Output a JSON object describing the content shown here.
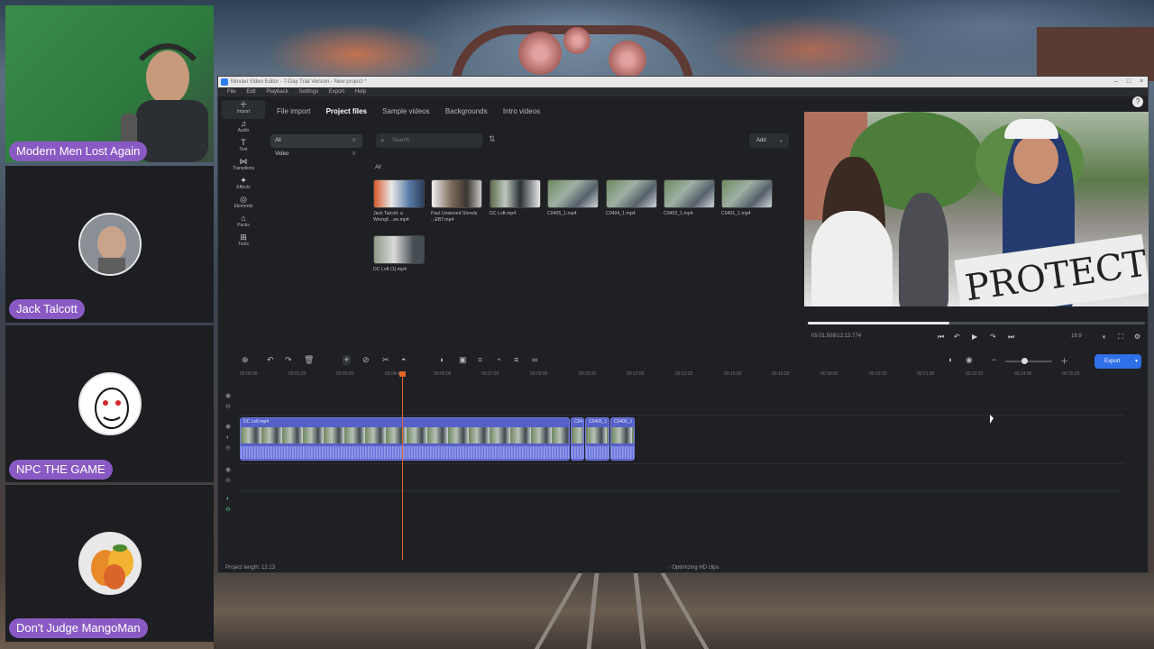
{
  "window": {
    "title": "Movavi Video Editor - 7-Day Trial Version - New project *",
    "controls": [
      "minimize-icon",
      "maximize-icon",
      "close-icon"
    ]
  },
  "menu": [
    "File",
    "Edit",
    "Playback",
    "Settings",
    "Export",
    "Help"
  ],
  "tools": [
    {
      "icon": "plus-icon",
      "label": "Import"
    },
    {
      "icon": "music-note-icon",
      "label": "Audio"
    },
    {
      "icon": "text-icon",
      "label": "Text"
    },
    {
      "icon": "transitions-icon",
      "label": "Transitions"
    },
    {
      "icon": "effects-icon",
      "label": "Effects"
    },
    {
      "icon": "elements-icon",
      "label": "Elements"
    },
    {
      "icon": "packs-icon",
      "label": "Packs"
    },
    {
      "icon": "tools-icon",
      "label": "Tools"
    }
  ],
  "tabs": [
    "File import",
    "Project files",
    "Sample videos",
    "Backgrounds",
    "Intro videos"
  ],
  "active_tab": "Project files",
  "filters": [
    {
      "label": "All",
      "count": "8"
    },
    {
      "label": "Video",
      "count": "8"
    }
  ],
  "search": {
    "placeholder": "Search"
  },
  "add_button": "Add",
  "section_label": "All",
  "media": [
    "Jack Talcott: a Wrongf....ee.mp4",
    "Paul Unsleved Shreds ...EBT.mp4",
    "DC Loft.mp4",
    "C0405_1.mp4",
    "C0404_1.mp4",
    "C0402_1.mp4",
    "C0401_1.mp4",
    "DC Loft (1).mp4"
  ],
  "preview": {
    "sign_text": "PROTECT",
    "timecode": "05:01.508/12:13.774",
    "aspect_ratio": "16:9",
    "progress": 0.42
  },
  "timeline": {
    "export_label": "Export",
    "ruler": [
      "00:00:00",
      "00:01:20",
      "00:03:00",
      "00:04:40",
      "00:06:00",
      "00:07:20",
      "00:09:00",
      "00:10:20",
      "00:12:00",
      "00:13:20",
      "00:15:00",
      "00:16:20",
      "00:18:00",
      "00:19:20",
      "00:21:00",
      "00:22:20",
      "00:24:00",
      "00:25:20"
    ],
    "clips": [
      {
        "name": "DC Loft.mp4"
      },
      {
        "name": "C04"
      },
      {
        "name": "C0405_1"
      },
      {
        "name": "C0405_1"
      }
    ]
  },
  "status": {
    "project_length": "Project length: 12:13",
    "optimizing": "Optimizing HD clips"
  },
  "webcams": [
    {
      "name": "Modern Men Lost Again"
    },
    {
      "name": "Jack Talcott"
    },
    {
      "name": "NPC THE GAME"
    },
    {
      "name": "Don't Judge MangoMan"
    }
  ]
}
